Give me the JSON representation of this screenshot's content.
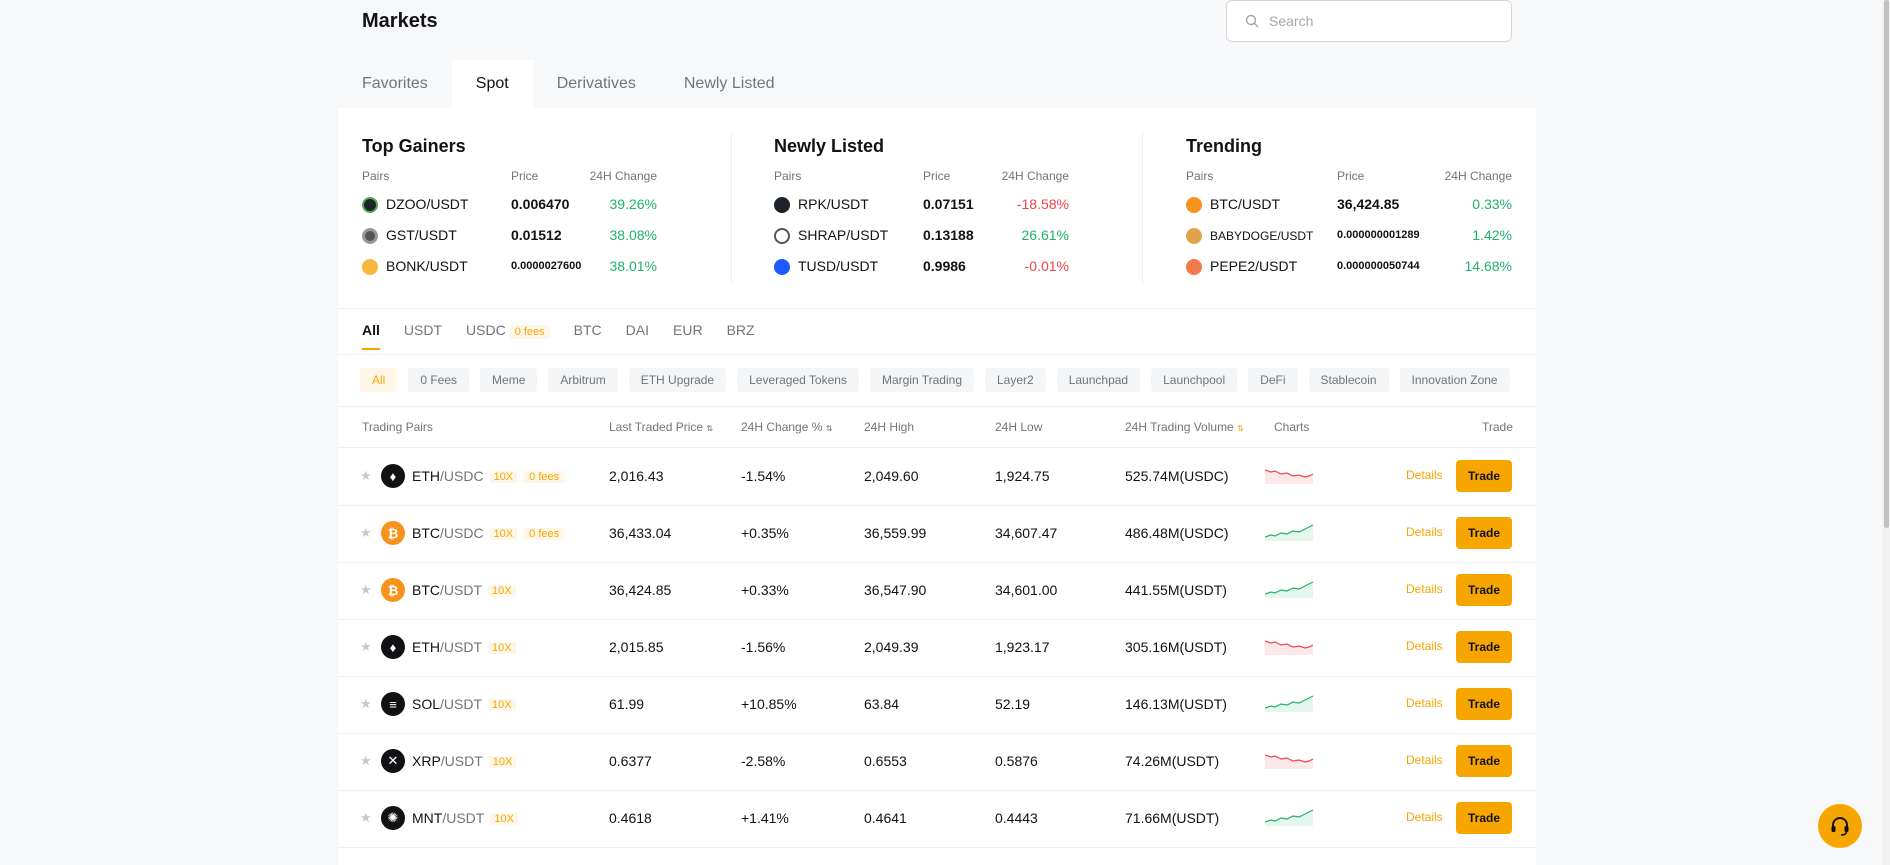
{
  "header": {
    "title": "Markets",
    "search_placeholder": "Search",
    "search_icon": "search-icon"
  },
  "tabs": [
    {
      "label": "Favorites"
    },
    {
      "label": "Spot"
    },
    {
      "label": "Derivatives"
    },
    {
      "label": "Newly Listed"
    }
  ],
  "highlights": {
    "columns": {
      "pairs": "Pairs",
      "price": "Price",
      "change": "24H Change"
    },
    "top_gainers": {
      "title": "Top Gainers",
      "rows": [
        {
          "pair": "DZOO/USDT",
          "price": "0.006470",
          "change": "39.26%"
        },
        {
          "pair": "GST/USDT",
          "price": "0.01512",
          "change": "38.08%"
        },
        {
          "pair": "BONK/USDT",
          "price": "0.0000027600",
          "change": "38.01%"
        }
      ]
    },
    "newly_listed": {
      "title": "Newly Listed",
      "rows": [
        {
          "pair": "RPK/USDT",
          "price": "0.07151",
          "change": "-18.58%"
        },
        {
          "pair": "SHRAP/USDT",
          "price": "0.13188",
          "change": "26.61%"
        },
        {
          "pair": "TUSD/USDT",
          "price": "0.9986",
          "change": "-0.01%"
        }
      ]
    },
    "trending": {
      "title": "Trending",
      "rows": [
        {
          "pair": "BTC/USDT",
          "price": "36,424.85",
          "change": "0.33%"
        },
        {
          "pair": "BABYDOGE/USDT",
          "price": "0.000000001289",
          "change": "1.42%"
        },
        {
          "pair": "PEPE2/USDT",
          "price": "0.000000050744",
          "change": "14.68%"
        }
      ]
    }
  },
  "quote_tabs": [
    {
      "label": "All"
    },
    {
      "label": "USDT"
    },
    {
      "label": "USDC",
      "badge": "0 fees"
    },
    {
      "label": "BTC"
    },
    {
      "label": "DAI"
    },
    {
      "label": "EUR"
    },
    {
      "label": "BRZ"
    }
  ],
  "categories": [
    "All",
    "0 Fees",
    "Meme",
    "Arbitrum",
    "ETH Upgrade",
    "Leveraged Tokens",
    "Margin Trading",
    "Layer2",
    "Launchpad",
    "Launchpool",
    "DeFi",
    "Stablecoin",
    "Innovation Zone"
  ],
  "table": {
    "headers": {
      "pairs": "Trading Pairs",
      "last": "Last Traded Price",
      "change": "24H Change %",
      "high": "24H High",
      "low": "24H Low",
      "volume": "24H Trading Volume",
      "charts": "Charts",
      "trade": "Trade"
    },
    "details_label": "Details",
    "trade_label": "Trade",
    "rows": [
      {
        "base": "ETH",
        "quote": "/USDC",
        "lev": "10X",
        "fees": "0 fees",
        "last": "2,016.43",
        "change": "-1.54%",
        "high": "2,049.60",
        "low": "1,924.75",
        "volume": "525.74M(USDC)"
      },
      {
        "base": "BTC",
        "quote": "/USDC",
        "lev": "10X",
        "fees": "0 fees",
        "last": "36,433.04",
        "change": "+0.35%",
        "high": "36,559.99",
        "low": "34,607.47",
        "volume": "486.48M(USDC)"
      },
      {
        "base": "BTC",
        "quote": "/USDT",
        "lev": "10X",
        "last": "36,424.85",
        "change": "+0.33%",
        "high": "36,547.90",
        "low": "34,601.00",
        "volume": "441.55M(USDT)"
      },
      {
        "base": "ETH",
        "quote": "/USDT",
        "lev": "10X",
        "last": "2,015.85",
        "change": "-1.56%",
        "high": "2,049.39",
        "low": "1,923.17",
        "volume": "305.16M(USDT)"
      },
      {
        "base": "SOL",
        "quote": "/USDT",
        "lev": "10X",
        "last": "61.99",
        "change": "+10.85%",
        "high": "63.84",
        "low": "52.19",
        "volume": "146.13M(USDT)"
      },
      {
        "base": "XRP",
        "quote": "/USDT",
        "lev": "10X",
        "last": "0.6377",
        "change": "-2.58%",
        "high": "0.6553",
        "low": "0.5876",
        "volume": "74.26M(USDT)"
      },
      {
        "base": "MNT",
        "quote": "/USDT",
        "lev": "10X",
        "last": "0.4618",
        "change": "+1.41%",
        "high": "0.4641",
        "low": "0.4443",
        "volume": "71.66M(USDT)"
      }
    ]
  },
  "colors": {
    "accent": "#f7a600",
    "up": "#20b26c",
    "down": "#ef454a"
  }
}
